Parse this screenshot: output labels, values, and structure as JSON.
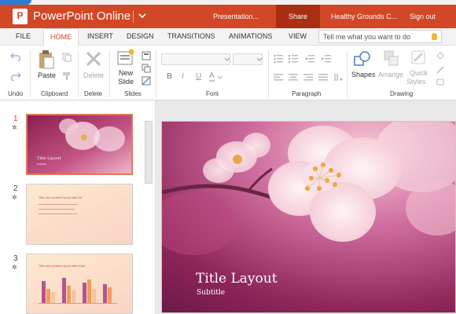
{
  "app": {
    "name": "PowerPoint Online",
    "logo_letter": "P",
    "presentation_name": "Presentation...",
    "share_label": "Share",
    "workspace_name": "Healthy Grounds C...",
    "signout_label": "Sign out",
    "accent_color": "#d24726"
  },
  "tabs": [
    {
      "label": "FILE"
    },
    {
      "label": "HOME",
      "active": true
    },
    {
      "label": "INSERT"
    },
    {
      "label": "DESIGN"
    },
    {
      "label": "TRANSITIONS"
    },
    {
      "label": "ANIMATIONS"
    },
    {
      "label": "VIEW"
    }
  ],
  "tell_me": {
    "placeholder": "Tell me what you want to do",
    "icon": "lightbulb-icon"
  },
  "ribbon": {
    "groups": {
      "undo": "Undo",
      "clipboard": "Clipboard",
      "delete": "Delete",
      "slides": "Slides",
      "font": "Font",
      "paragraph": "Paragraph",
      "drawing": "Drawing"
    },
    "buttons": {
      "paste": "Paste",
      "delete": "Delete",
      "new_slide_line1": "New",
      "new_slide_line2": "Slide",
      "shapes": "Shapes",
      "arrange": "Arrange",
      "quick_styles_line1": "Quick",
      "quick_styles_line2": "Styles"
    },
    "font_buttons": {
      "bold": "B",
      "italic": "I",
      "underline": "U",
      "font_color": "A"
    }
  },
  "slides": [
    {
      "number": "1",
      "star": "✲",
      "title": "Title Layout",
      "subtitle": "Subtitle"
    },
    {
      "number": "2",
      "star": "✲",
      "title": "Title and content layout with list"
    },
    {
      "number": "3",
      "star": "✲",
      "title": "Title and content layout with chart"
    }
  ],
  "current_slide": {
    "title": "Title Layout",
    "subtitle": "Subtitle"
  }
}
